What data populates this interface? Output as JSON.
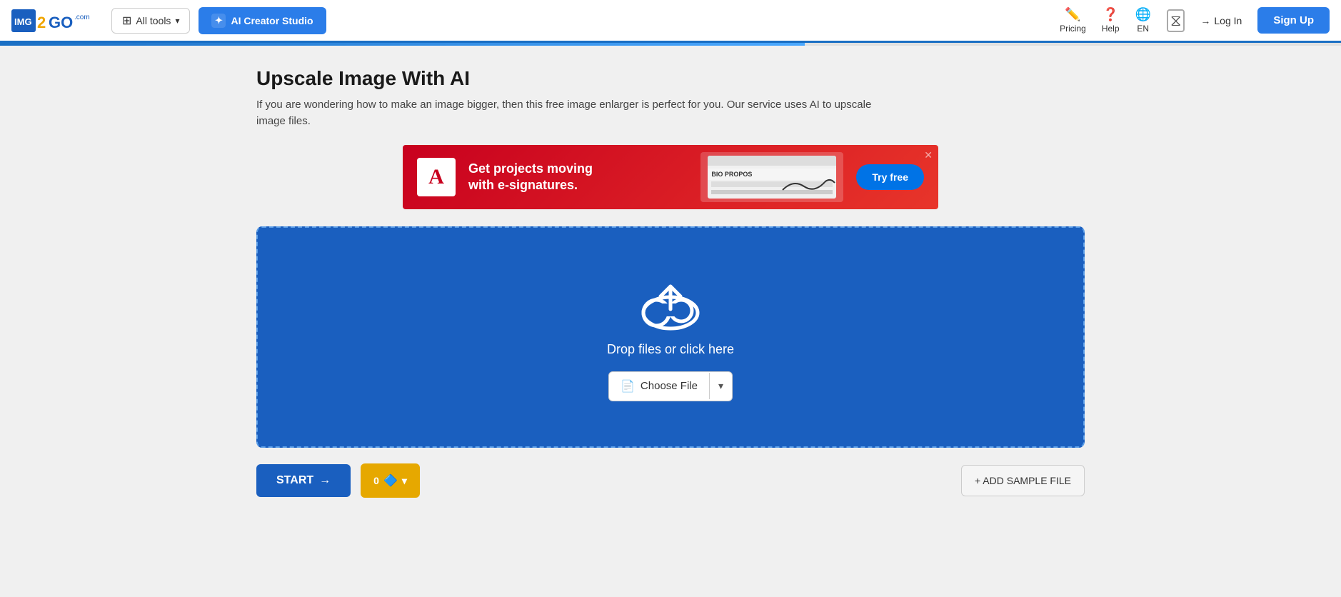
{
  "header": {
    "logo_text_img": "IMG",
    "logo_text_2go": "2GO",
    "all_tools_label": "All tools",
    "ai_creator_label": "AI Creator Studio",
    "nav": {
      "pricing_label": "Pricing",
      "help_label": "Help",
      "lang_label": "EN"
    },
    "login_label": "Log In",
    "signup_label": "Sign Up"
  },
  "page": {
    "title": "Upscale Image With AI",
    "description": "If you are wondering how to make an image bigger, then this free image enlarger is perfect for you. Our service uses AI to upscale image files."
  },
  "ad": {
    "logo_letter": "A",
    "headline": "Get projects moving",
    "headline2": "with e-signatures.",
    "try_label": "Try free",
    "mock_text": "BIO PROPOS"
  },
  "upload": {
    "drop_text": "Drop files or click here",
    "choose_file_label": "Choose File",
    "choose_file_icon": "📄"
  },
  "bottom": {
    "start_label": "START",
    "quality_label": "0",
    "add_sample_label": "+ ADD SAMPLE FILE"
  }
}
